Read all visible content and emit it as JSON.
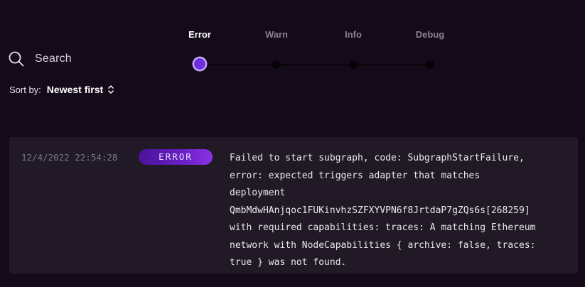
{
  "search": {
    "label": "Search"
  },
  "sort": {
    "label": "Sort by:",
    "value": "Newest first"
  },
  "levels": [
    {
      "label": "Error",
      "active": true
    },
    {
      "label": "Warn",
      "active": false
    },
    {
      "label": "Info",
      "active": false
    },
    {
      "label": "Debug",
      "active": false
    }
  ],
  "log": {
    "timestamp": "12/4/2022 22:54:28",
    "level": "ERROR",
    "message": "Failed to start subgraph, code: SubgraphStartFailure,\nerror: expected triggers adapter that matches\ndeployment\nQmbMdwHAnjqoc1FUKinvhzSZFXYVPN6f8JrtdaP7gZQs6s[268259]\nwith required capabilities: traces: A matching Ethereum\nnetwork with NodeCapabilities { archive: false, traces:\ntrue } was not found."
  },
  "colors": {
    "background": "#150a19",
    "accent": "#6f2fe0",
    "card": "#211a26"
  }
}
